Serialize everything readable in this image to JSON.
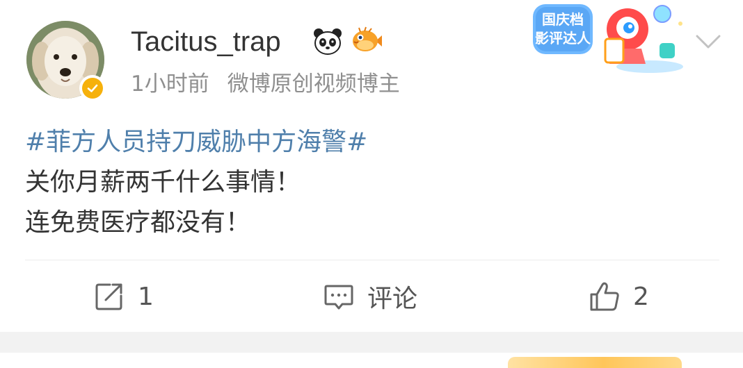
{
  "post": {
    "username": "Tacitus_trap",
    "name_icons": [
      "panda-icon",
      "pufferfish-icon"
    ],
    "time": "1小时前",
    "source": "微博原创视频博主",
    "badge": {
      "line1": "国庆档",
      "line2": "影评达人"
    },
    "topic": "#菲方人员持刀威胁中方海警#",
    "text_lines": [
      "关你月薪两千什么事情！",
      "连免费医疗都没有！"
    ]
  },
  "actions": {
    "repost_count": "1",
    "comment_label": "评论",
    "like_count": "2"
  },
  "colors": {
    "topic": "#4f7fab",
    "verified": "#f6b10c",
    "meta": "#8f8f8f",
    "text": "#333333"
  }
}
